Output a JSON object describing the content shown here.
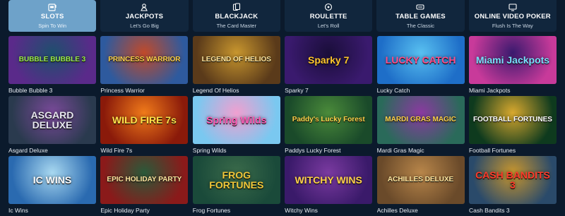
{
  "tabs": [
    {
      "label": "Slots",
      "sub": "Spin To Win",
      "icon": "slot-machine-icon",
      "active": true
    },
    {
      "label": "Jackpots",
      "sub": "Let's Go Big",
      "icon": "jackpot-icon",
      "active": false
    },
    {
      "label": "Blackjack",
      "sub": "The Card Master",
      "icon": "cards-icon",
      "active": false
    },
    {
      "label": "Roulette",
      "sub": "Let's Roll",
      "icon": "roulette-icon",
      "active": false
    },
    {
      "label": "Table Games",
      "sub": "The Classic",
      "icon": "table-icon",
      "active": false
    },
    {
      "label": "Online Video Poker",
      "sub": "Flush Is The Way",
      "icon": "poker-icon",
      "active": false
    }
  ],
  "games": [
    {
      "name": "Bubble Bubble 3",
      "art": "BUBBLE BUBBLE 3",
      "bg": "#5a2a8a",
      "bg2": "#1f4f6e",
      "fg": "#9cf04a"
    },
    {
      "name": "Princess Warrior",
      "art": "PRINCESS WARRIOR",
      "bg": "#2e5a9e",
      "bg2": "#c14a2a",
      "fg": "#ffd24a"
    },
    {
      "name": "Legend Of Helios",
      "art": "LEGEND OF HELIOS",
      "bg": "#5a3a1a",
      "bg2": "#c8962e",
      "fg": "#ffe7a0"
    },
    {
      "name": "Sparky 7",
      "art": "Sparky 7",
      "bg": "#3a1a6e",
      "bg2": "#1a0e3a",
      "fg": "#ffc62e"
    },
    {
      "name": "Lucky Catch",
      "art": "LUCKY CATCH",
      "bg": "#1e6ec8",
      "bg2": "#58c0f0",
      "fg": "#ff4d8a"
    },
    {
      "name": "Miami Jackpots",
      "art": "Miami Jackpots",
      "bg": "#c83a9a",
      "bg2": "#3a1a6e",
      "fg": "#7ae0ff"
    },
    {
      "name": "Asgard Deluxe",
      "art": "ASGARD DELUXE",
      "bg": "#2a3a4e",
      "bg2": "#7a4a9a",
      "fg": "#e8e8f0"
    },
    {
      "name": "Wild Fire 7s",
      "art": "WILD FIRE 7s",
      "bg": "#8a1a0a",
      "bg2": "#f07a1a",
      "fg": "#ffe14a"
    },
    {
      "name": "Spring Wilds",
      "art": "Spring Wilds",
      "bg": "#7ac8f0",
      "bg2": "#f0a0d0",
      "fg": "#ff5ab4"
    },
    {
      "name": "Paddys Lucky Forest",
      "art": "Paddy's Lucky Forest",
      "bg": "#1a4a2a",
      "bg2": "#4a8a3a",
      "fg": "#ffd24a"
    },
    {
      "name": "Mardi Gras Magic",
      "art": "MARDI GRAS MAGIC",
      "bg": "#2a6a5a",
      "bg2": "#8a3aa0",
      "fg": "#ffd24a"
    },
    {
      "name": "Football Fortunes",
      "art": "FOOTBALL FORTUNES",
      "bg": "#0e3a1e",
      "bg2": "#d8a82e",
      "fg": "#ffffff"
    },
    {
      "name": "Ic Wins",
      "art": "IC WINS",
      "bg": "#2a6ab0",
      "bg2": "#a8d8f0",
      "fg": "#ffffff"
    },
    {
      "name": "Epic Holiday Party",
      "art": "EPIC HOLIDAY PARTY",
      "bg": "#8a1a1a",
      "bg2": "#2a5a3a",
      "fg": "#ffe7a0"
    },
    {
      "name": "Frog Fortunes",
      "art": "FROG FORTUNES",
      "bg": "#1a4a3a",
      "bg2": "#3a6a4a",
      "fg": "#f0c83a"
    },
    {
      "name": "Witchy Wins",
      "art": "WITCHY WINS",
      "bg": "#3a1a6a",
      "bg2": "#7a3aa0",
      "fg": "#ffd24a"
    },
    {
      "name": "Achilles Deluxe",
      "art": "ACHILLES DELUXE",
      "bg": "#6a4a2a",
      "bg2": "#b8864a",
      "fg": "#ffe7a0"
    },
    {
      "name": "Cash Bandits 3",
      "art": "CASH BANDITS 3",
      "bg": "#2a4a6a",
      "bg2": "#c8962e",
      "fg": "#ff3a2a"
    }
  ],
  "colors": {
    "background": "#0b1a2c",
    "tab": "#11263d",
    "tab_active": "#6ea2c9"
  }
}
